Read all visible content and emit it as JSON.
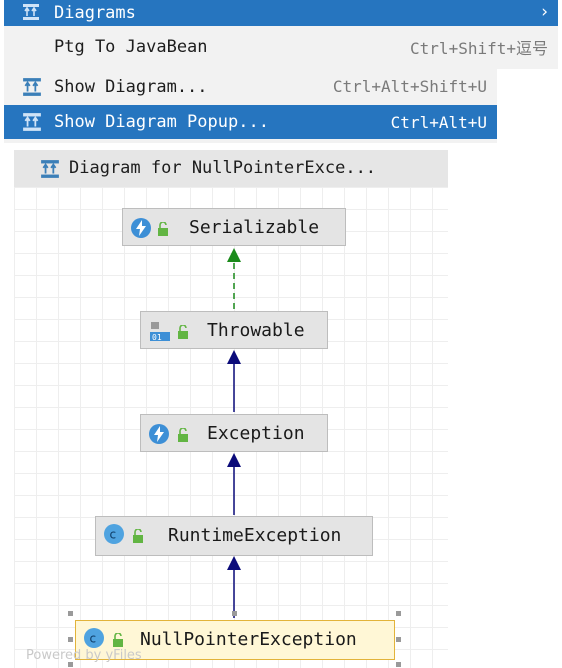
{
  "menu": {
    "diagrams": "Diagrams",
    "ptg": "Ptg To JavaBean",
    "ptg_shortcut": "Ctrl+Shift+逗号",
    "show_diagram": "Show Diagram...",
    "show_diagram_shortcut": "Ctrl+Alt+Shift+U",
    "show_popup": "Show Diagram Popup...",
    "show_popup_shortcut": "Ctrl+Alt+U"
  },
  "diagram": {
    "title": "Diagram for NullPointerExce...",
    "nodes": {
      "serializable": "Serializable",
      "throwable": "Throwable",
      "exception": "Exception",
      "runtime": "RuntimeException",
      "npe": "NullPointerException"
    },
    "watermark": "Powered by yFiles"
  },
  "colors": {
    "selection": "#2675bf",
    "implements_arrow": "#1a8a1a",
    "extends_arrow": "#0b0b7a"
  }
}
